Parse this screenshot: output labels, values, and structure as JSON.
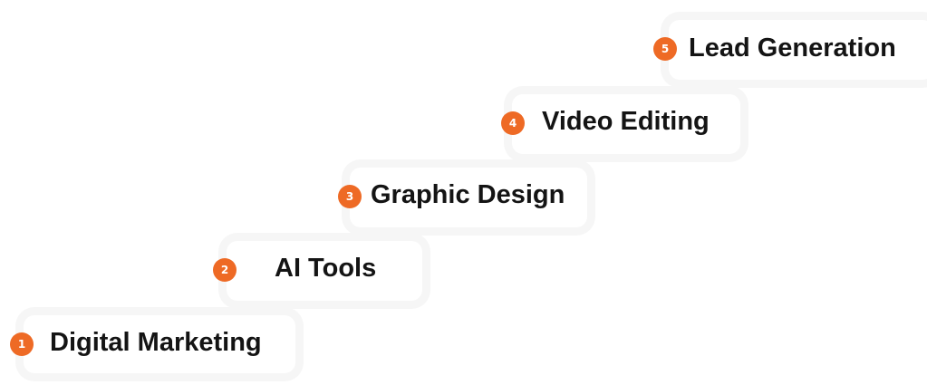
{
  "accent_color": "#ee6a25",
  "steps": [
    {
      "number": "1",
      "label": "Digital Marketing"
    },
    {
      "number": "2",
      "label": "AI Tools"
    },
    {
      "number": "3",
      "label": "Graphic Design"
    },
    {
      "number": "4",
      "label": "Video Editing"
    },
    {
      "number": "5",
      "label": "Lead Generation"
    }
  ]
}
